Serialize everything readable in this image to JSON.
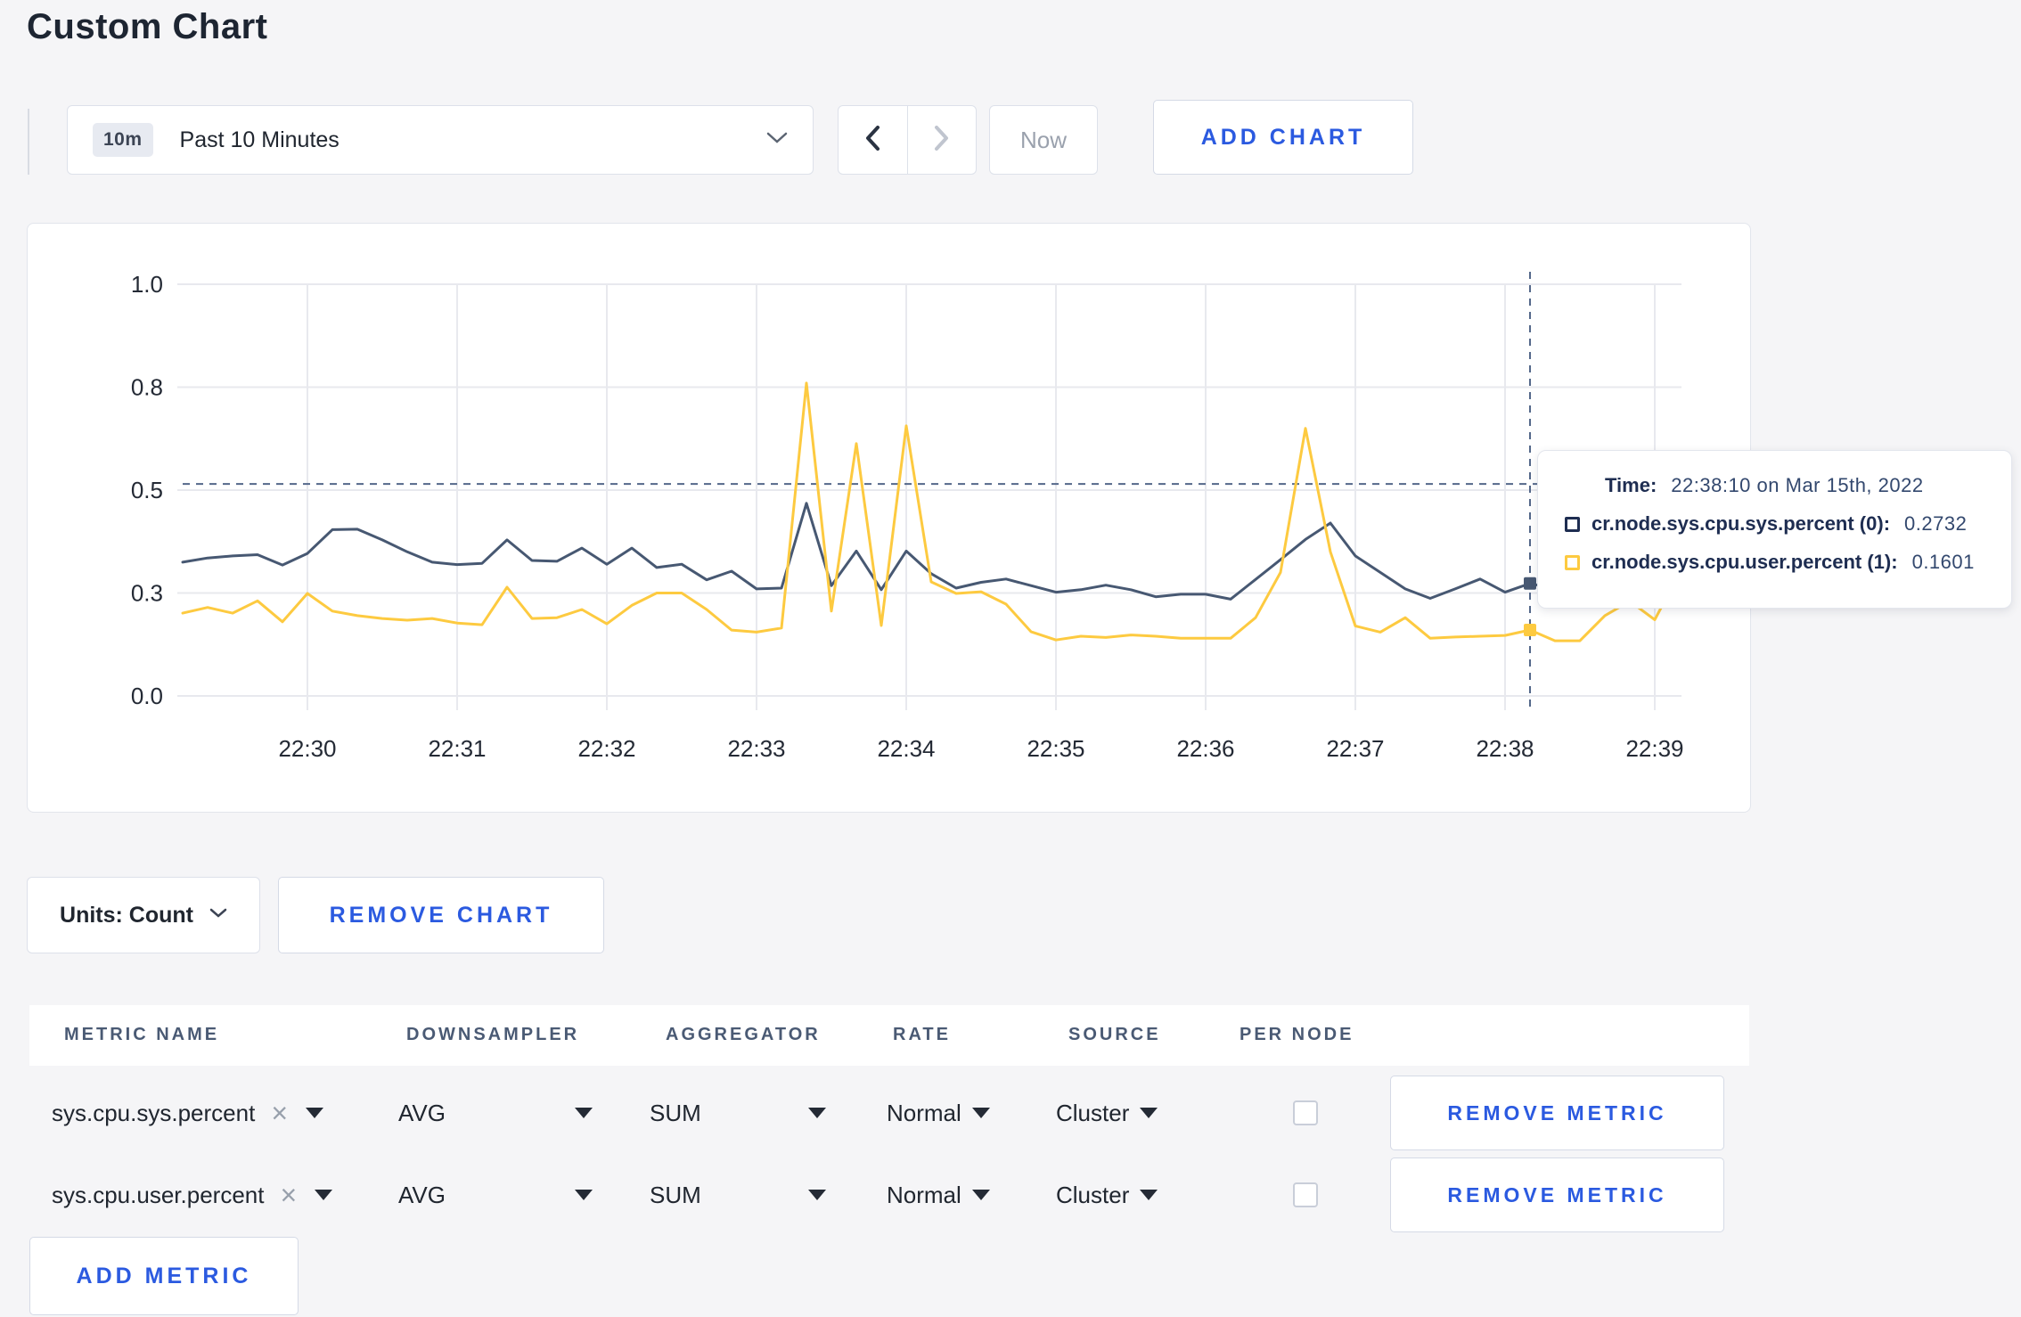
{
  "page": {
    "title": "Custom Chart"
  },
  "controls": {
    "time_range": {
      "badge": "10m",
      "label": "Past 10 Minutes"
    },
    "now_label": "Now",
    "add_chart_label": "ADD CHART"
  },
  "chart_data": {
    "type": "line",
    "title": "",
    "x_start": "22:29:10",
    "x_interval_seconds": 10,
    "x_axis_ticks": [
      "22:30",
      "22:31",
      "22:32",
      "22:33",
      "22:34",
      "22:35",
      "22:36",
      "22:37",
      "22:38",
      "22:39"
    ],
    "y_axis": {
      "min": 0,
      "max": 1,
      "tick_values": [
        0,
        0.25,
        0.5,
        0.75,
        1
      ],
      "tick_labels": [
        "0.0",
        "0.3",
        "0.5",
        "0.8",
        "1.0"
      ]
    },
    "grid": true,
    "legend_position": "tooltip",
    "series": [
      {
        "name": "cr.node.sys.cpu.sys.percent",
        "color": "#475872",
        "values": [
          0.325,
          0.335,
          0.34,
          0.343,
          0.318,
          0.346,
          0.404,
          0.405,
          0.379,
          0.35,
          0.325,
          0.319,
          0.322,
          0.379,
          0.329,
          0.327,
          0.359,
          0.32,
          0.359,
          0.312,
          0.32,
          0.282,
          0.303,
          0.26,
          0.262,
          0.468,
          0.268,
          0.352,
          0.258,
          0.352,
          0.297,
          0.262,
          0.276,
          0.284,
          0.268,
          0.252,
          0.258,
          0.269,
          0.258,
          0.241,
          0.247,
          0.247,
          0.235,
          0.283,
          0.331,
          0.38,
          0.42,
          0.34,
          0.3,
          0.26,
          0.237,
          0.26,
          0.284,
          0.252,
          0.2732,
          0.26,
          0.27,
          0.275,
          0.27,
          0.28,
          0.285
        ]
      },
      {
        "name": "cr.node.sys.cpu.user.percent",
        "color": "#fdca40",
        "values": [
          0.201,
          0.215,
          0.201,
          0.231,
          0.18,
          0.249,
          0.206,
          0.195,
          0.188,
          0.184,
          0.188,
          0.177,
          0.173,
          0.264,
          0.188,
          0.19,
          0.21,
          0.175,
          0.22,
          0.25,
          0.25,
          0.21,
          0.16,
          0.155,
          0.165,
          0.76,
          0.206,
          0.613,
          0.171,
          0.656,
          0.277,
          0.249,
          0.253,
          0.223,
          0.156,
          0.136,
          0.145,
          0.142,
          0.148,
          0.145,
          0.14,
          0.14,
          0.14,
          0.19,
          0.3,
          0.65,
          0.35,
          0.17,
          0.155,
          0.19,
          0.14,
          0.143,
          0.145,
          0.147,
          0.1601,
          0.134,
          0.134,
          0.195,
          0.23,
          0.185,
          0.3
        ]
      }
    ],
    "crosshair": {
      "time": "22:38:10",
      "x_fraction": 0.9,
      "hline_value": 0.515,
      "point_values": [
        0.2732,
        0.1601
      ]
    }
  },
  "tooltip": {
    "time_label": "Time:",
    "time_value": "22:38:10 on Mar 15th, 2022",
    "series": [
      {
        "name": "cr.node.sys.cpu.sys.percent (0):",
        "value": "0.2732",
        "color": "#1e2d51"
      },
      {
        "name": "cr.node.sys.cpu.user.percent (1):",
        "value": "0.1601",
        "color": "#fdca40"
      }
    ]
  },
  "units_row": {
    "units_label": "Units: Count",
    "remove_chart_label": "REMOVE CHART"
  },
  "table": {
    "headers": [
      "METRIC NAME",
      "DOWNSAMPLER",
      "AGGREGATOR",
      "RATE",
      "SOURCE",
      "PER NODE"
    ],
    "rows": [
      {
        "metric_name": "sys.cpu.sys.percent",
        "downsampler": "AVG",
        "aggregator": "SUM",
        "rate": "Normal",
        "source": "Cluster",
        "per_node_checked": false,
        "remove_label": "REMOVE METRIC"
      },
      {
        "metric_name": "sys.cpu.user.percent",
        "downsampler": "AVG",
        "aggregator": "SUM",
        "rate": "Normal",
        "source": "Cluster",
        "per_node_checked": false,
        "remove_label": "REMOVE METRIC"
      }
    ],
    "add_metric_label": "ADD METRIC"
  },
  "colors": {
    "accent_blue": "#2b5ae0",
    "series_sys": "#475872",
    "series_user": "#fdca40",
    "crosshair": "#54688a"
  }
}
